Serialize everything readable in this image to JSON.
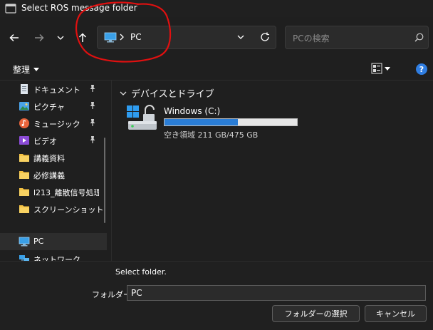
{
  "window": {
    "title": "Select ROS message folder"
  },
  "address": {
    "location": "PC"
  },
  "search": {
    "placeholder": "PCの検索"
  },
  "commandbar": {
    "organize_label": "整理"
  },
  "sidebar": {
    "items": [
      {
        "label": "ドキュメント",
        "icon": "documents-icon",
        "pinned": true
      },
      {
        "label": "ピクチャ",
        "icon": "pictures-icon",
        "pinned": true
      },
      {
        "label": "ミュージック",
        "icon": "music-icon",
        "pinned": true
      },
      {
        "label": "ビデオ",
        "icon": "videos-icon",
        "pinned": true
      },
      {
        "label": "講義資料",
        "icon": "folder-icon",
        "pinned": false
      },
      {
        "label": "必修講義",
        "icon": "folder-icon",
        "pinned": false
      },
      {
        "label": "l213_離散信号処理",
        "icon": "folder-icon",
        "pinned": false
      },
      {
        "label": "スクリーンショット",
        "icon": "folder-icon",
        "pinned": false
      },
      {
        "label": "PC",
        "icon": "pc-icon",
        "pinned": false,
        "selected": true
      },
      {
        "label": "ネットワーク",
        "icon": "network-icon",
        "pinned": false
      }
    ]
  },
  "content": {
    "section_title": "デバイスとドライブ",
    "drive": {
      "name": "Windows (C:)",
      "space_text": "空き領域 211 GB/475 GB",
      "used_fraction": 0.556
    }
  },
  "footer": {
    "message": "Select folder.",
    "folder_label": "フォルダー:",
    "folder_value": "PC",
    "select_button": "フォルダーの選択",
    "cancel_button": "キャンセル"
  },
  "colors": {
    "accent": "#2a7dd6",
    "annotation": "#e01010",
    "folder": "#f6c343"
  }
}
